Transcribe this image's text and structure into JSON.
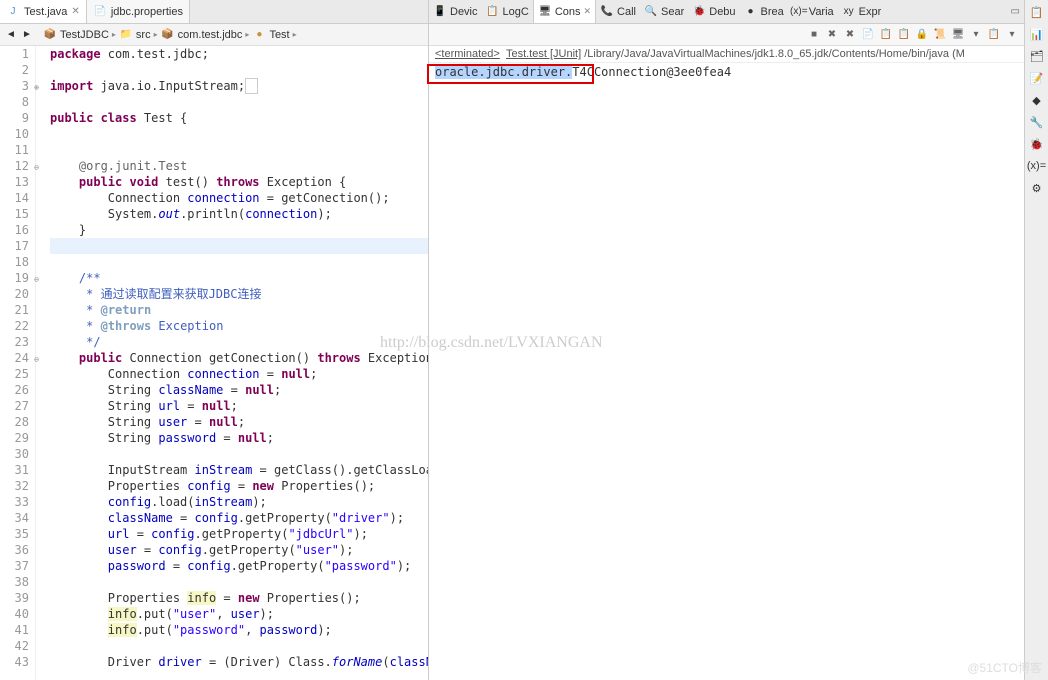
{
  "editor_tabs": [
    {
      "icon": "J",
      "label": "Test.java",
      "active": true
    },
    {
      "icon": "📄",
      "label": "jdbc.properties",
      "active": false
    }
  ],
  "breadcrumb": {
    "items": [
      {
        "icon": "📦",
        "label": "TestJDBC"
      },
      {
        "icon": "📁",
        "label": "src"
      },
      {
        "icon": "📦",
        "label": "com.test.jdbc"
      },
      {
        "icon": "●",
        "label": "Test"
      }
    ]
  },
  "code_lines": [
    {
      "n": 1,
      "html": "<span class='kw'>package</span> com.test.jdbc;"
    },
    {
      "n": 2,
      "html": ""
    },
    {
      "n": 3,
      "fold": "⊕",
      "html": "<span class='kw'>import</span> java.io.InputStream;<span style='border:1px solid #ccc;padding:0 2px'>&nbsp;</span>"
    },
    {
      "n": 8,
      "html": ""
    },
    {
      "n": 9,
      "html": "<span class='kw'>public class</span> Test {"
    },
    {
      "n": 10,
      "html": ""
    },
    {
      "n": 11,
      "html": ""
    },
    {
      "n": 12,
      "fold": "⊖",
      "html": "    <span class='ann'>@org.junit.Test</span>"
    },
    {
      "n": 13,
      "html": "    <span class='kw'>public void</span> test() <span class='kw'>throws</span> Exception {"
    },
    {
      "n": 14,
      "html": "        Connection <span class='fld'>connection</span> = getConection();"
    },
    {
      "n": 15,
      "html": "        System.<span class='stat'>out</span>.println(<span class='fld'>connection</span>);"
    },
    {
      "n": 16,
      "html": "    }"
    },
    {
      "n": 17,
      "hl": true,
      "html": "    "
    },
    {
      "n": 18,
      "html": ""
    },
    {
      "n": 19,
      "fold": "⊖",
      "html": "    <span class='doc'>/**</span>"
    },
    {
      "n": 20,
      "html": "    <span class='doc'> * 通过读取配置来获取JDBC连接</span>"
    },
    {
      "n": 21,
      "html": "    <span class='doc'> * <span class='doctag'>@return</span></span>"
    },
    {
      "n": 22,
      "html": "    <span class='doc'> * <span class='doctag'>@throws</span> Exception</span>"
    },
    {
      "n": 23,
      "html": "    <span class='doc'> */</span>"
    },
    {
      "n": 24,
      "fold": "⊖",
      "html": "    <span class='kw'>public</span> Connection getConection() <span class='kw'>throws</span> Exception {"
    },
    {
      "n": 25,
      "html": "        Connection <span class='fld'>connection</span> = <span class='kw'>null</span>;"
    },
    {
      "n": 26,
      "html": "        String <span class='fld'>className</span> = <span class='kw'>null</span>;"
    },
    {
      "n": 27,
      "html": "        String <span class='fld'>url</span> = <span class='kw'>null</span>;"
    },
    {
      "n": 28,
      "html": "        String <span class='fld'>user</span> = <span class='kw'>null</span>;"
    },
    {
      "n": 29,
      "html": "        String <span class='fld'>password</span> = <span class='kw'>null</span>;"
    },
    {
      "n": 30,
      "html": ""
    },
    {
      "n": 31,
      "html": "        InputStream <span class='fld'>inStream</span> = getClass().getClassLoad"
    },
    {
      "n": 32,
      "html": "        Properties <span class='fld'>config</span> = <span class='kw'>new</span> Properties();"
    },
    {
      "n": 33,
      "html": "        <span class='fld'>config</span>.load(<span class='fld'>inStream</span>);"
    },
    {
      "n": 34,
      "html": "        <span class='fld'>className</span> = <span class='fld'>config</span>.getProperty(<span class='str'>\"driver\"</span>);"
    },
    {
      "n": 35,
      "html": "        <span class='fld'>url</span> = <span class='fld'>config</span>.getProperty(<span class='str'>\"jdbcUrl\"</span>);"
    },
    {
      "n": 36,
      "html": "        <span class='fld'>user</span> = <span class='fld'>config</span>.getProperty(<span class='str'>\"user\"</span>);"
    },
    {
      "n": 37,
      "html": "        <span class='fld'>password</span> = <span class='fld'>config</span>.getProperty(<span class='str'>\"password\"</span>);"
    },
    {
      "n": 38,
      "html": ""
    },
    {
      "n": 39,
      "html": "        Properties <span class='warn'>info</span> = <span class='kw'>new</span> Properties();"
    },
    {
      "n": 40,
      "html": "        <span class='warn'>info</span>.put(<span class='str'>\"user\"</span>, <span class='fld'>user</span>);"
    },
    {
      "n": 41,
      "html": "        <span class='warn'>info</span>.put(<span class='str'>\"password\"</span>, <span class='fld'>password</span>);"
    },
    {
      "n": 42,
      "html": ""
    },
    {
      "n": 43,
      "html": "        Driver <span class='fld'>driver</span> = (Driver) Class.<span class='stat'>forName</span>(<span class='fld'>className</span>).newInstance();"
    }
  ],
  "right_tabs": [
    {
      "icon": "📱",
      "label": "Devic"
    },
    {
      "icon": "📋",
      "label": "LogC"
    },
    {
      "icon": "🖥",
      "label": "Cons",
      "active": true
    },
    {
      "icon": "📞",
      "label": "Call"
    },
    {
      "icon": "🔍",
      "label": "Sear"
    },
    {
      "icon": "🐞",
      "label": "Debu"
    },
    {
      "icon": "●",
      "label": "Brea"
    },
    {
      "icon": "(x)=",
      "label": "Varia"
    },
    {
      "icon": "xy",
      "label": "Expr"
    }
  ],
  "console": {
    "status_prefix": "<terminated>",
    "status_title": "Test.test [JUnit]",
    "status_path": " /Library/Java/JavaVirtualMachines/jdk1.8.0_65.jdk/Contents/Home/bin/java (M",
    "output_highlight": "oracle.jdbc.driver.",
    "output_rest": "T4CConnection@3ee0fea4",
    "toolbar_icons": [
      "■",
      "✖",
      "✖",
      "📄",
      "📋",
      "📋",
      "🔒",
      "📜",
      "🖥",
      "▾",
      "📋",
      "▾"
    ]
  },
  "side_icons": [
    "📋",
    "📊",
    "🗂",
    "📝",
    "◆",
    "🔧",
    "🐞",
    "(x)=",
    "⚙"
  ],
  "watermark": "http://blog.csdn.net/LVXIANGAN",
  "watermark2": "@51CTO博客"
}
